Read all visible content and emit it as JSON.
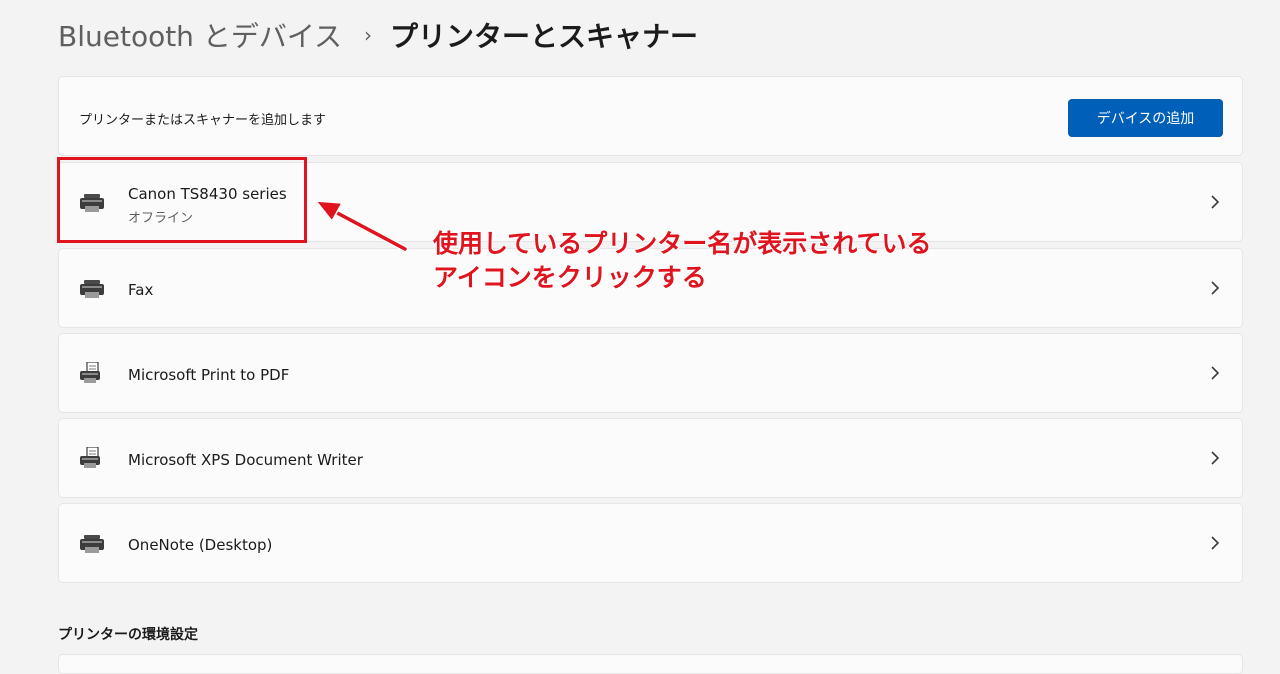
{
  "breadcrumb": {
    "parent": "Bluetooth とデバイス",
    "separator": "›",
    "current": "プリンターとスキャナー"
  },
  "add_device": {
    "label": "プリンターまたはスキャナーを追加します",
    "button": "デバイスの追加"
  },
  "printers": [
    {
      "name": "Canon TS8430 series",
      "status": "オフライン",
      "icon": "printer-icon"
    },
    {
      "name": "Fax",
      "icon": "printer-icon"
    },
    {
      "name": "Microsoft Print to PDF",
      "icon": "document-printer-icon"
    },
    {
      "name": "Microsoft XPS Document Writer",
      "icon": "document-printer-icon"
    },
    {
      "name": "OneNote (Desktop)",
      "icon": "printer-icon"
    }
  ],
  "annotation": {
    "text": "使用しているプリンター名が表示されている\nアイコンをクリックする",
    "color": "#e0141e"
  },
  "printer_preferences": {
    "heading": "プリンターの環境設定"
  },
  "colors": {
    "accent": "#005fb8",
    "background": "#f3f3f3",
    "card": "#fbfbfb"
  }
}
